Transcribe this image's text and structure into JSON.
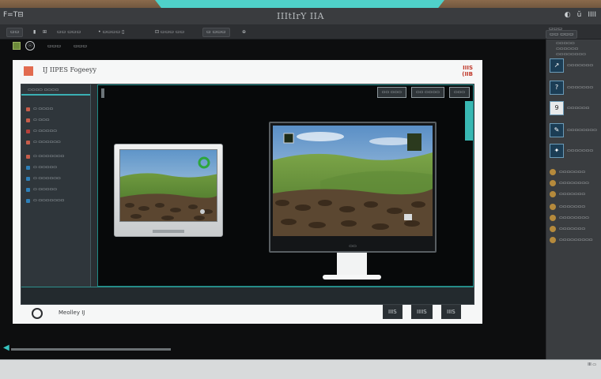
{
  "window": {
    "left_label": "F=T⊟",
    "title": "IIItIrY IIA",
    "controls": [
      "◐",
      "ŭ",
      "IIII"
    ]
  },
  "toolbar": {
    "items": [
      {
        "label": "▭▭"
      },
      {
        "label": "▮"
      },
      {
        "label": "⊞"
      },
      {
        "label": "▭▭ ▭▭▭"
      },
      {
        "label": "• ▭▭▭▭  ▯"
      },
      {
        "label": "⊡ ▭▭▭ ▭▭"
      },
      {
        "label": "▭ ▭▭▭"
      },
      {
        "label": "⊕"
      }
    ],
    "right_items": [
      "▭▭▭",
      "▭▭ ▭▭▭"
    ]
  },
  "workspace": {
    "header_icon_label": "☉",
    "header_text_a": "▭▭▭",
    "header_text_b": "▭▭▭"
  },
  "card": {
    "app_title": "IJ IIPES Fogeeyy",
    "badge_line1": "IIIS",
    "badge_line2": "(IIB"
  },
  "sidebar": {
    "header": "▭▭▭▭ ▭▭▭▭",
    "items": [
      {
        "label": "▭ ▭▭▭▭",
        "color": "#c65c4a"
      },
      {
        "label": "▭ ▭▭▭",
        "color": "#c65c4a"
      },
      {
        "label": "▭ ▭▭▭▭▭",
        "color": "#b5403a"
      },
      {
        "label": "▭ ▭▭▭▭▭▭",
        "color": "#c65c4a"
      },
      {
        "label": "▭ ▭▭▭▭▭▭▭",
        "color": "#c65c4a"
      },
      {
        "label": "▭ ▭▭▭▭▭",
        "color": "#2d7fb8"
      },
      {
        "label": "▭ ▭▭▭▭▭▭",
        "color": "#2d7fb8"
      },
      {
        "label": "▭ ▭▭▭▭▭",
        "color": "#2d7fb8"
      },
      {
        "label": "▭ ▭▭▭▭▭▭▭",
        "color": "#2d7fb8"
      }
    ]
  },
  "stage": {
    "tools": [
      "▭▭ ▭▭▭",
      "▭▭ ▭▭▭▭",
      "▭▭▭"
    ],
    "monitor_brand": "▭▭"
  },
  "card_footer": {
    "label": "Meolley IJ",
    "buttons": [
      "IIIS",
      "IIIIS",
      "IIIS"
    ]
  },
  "right_panel": {
    "top_lines": [
      "▭▭▭▭▭",
      "▭▭▭▭▭▭",
      "▭▭▭▭▭▭▭▭"
    ],
    "rows": [
      {
        "thumb": "↗",
        "label": "▭▭▭▭▭▭▭"
      },
      {
        "thumb": "?",
        "label": "▭▭▭▭▭▭▭"
      },
      {
        "thumb": "9",
        "label": "▭▭▭▭▭▭"
      },
      {
        "thumb": "✎",
        "label": "▭▭▭▭▭▭▭▭"
      },
      {
        "thumb": "✦",
        "label": "▭▭▭▭▭▭▭"
      }
    ],
    "small_rows": [
      "▭▭▭▭▭▭▭",
      "▭▭▭▭▭▭▭▭",
      "▭▭▭▭▭▭▭",
      "▭▭▭▭▭▭▭",
      "▭▭▭▭▭▭▭▭",
      "▭▭▭▭▭▭▭",
      "▭▭▭▭▭▭▭▭▭"
    ]
  },
  "status": {
    "right": "III ▭"
  }
}
